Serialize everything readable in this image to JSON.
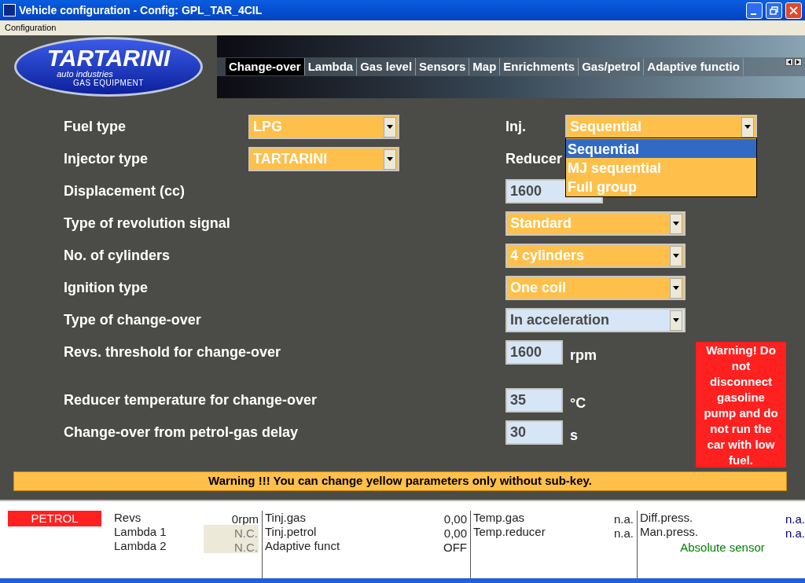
{
  "window": {
    "title": "Vehicle configuration - Config: GPL_TAR_4CIL"
  },
  "menu": [
    "Configuration"
  ],
  "logo": {
    "name": "TARTARINI",
    "subtitle": "auto industries",
    "tagline": "GAS EQUIPMENT"
  },
  "tabs": [
    {
      "label": "Change-over",
      "selected": true
    },
    {
      "label": "Lambda",
      "selected": false
    },
    {
      "label": "Gas level",
      "selected": false
    },
    {
      "label": "Sensors",
      "selected": false
    },
    {
      "label": "Map",
      "selected": false
    },
    {
      "label": "Enrichments",
      "selected": false
    },
    {
      "label": "Gas/petrol",
      "selected": false
    },
    {
      "label": "Adaptive functio",
      "selected": false
    }
  ],
  "form": {
    "groups": [
      [
        {
          "label": "Fuel type",
          "control": {
            "kind": "select",
            "value": "LPG",
            "editable": true
          },
          "side": {
            "label": "Inj.",
            "control": {
              "kind": "select",
              "value": "Sequential",
              "editable": true,
              "open": true,
              "options": [
                {
                  "label": "Sequential",
                  "selected": true
                },
                {
                  "label": "MJ sequential",
                  "selected": false
                },
                {
                  "label": "Full group",
                  "selected": false
                }
              ]
            }
          }
        },
        {
          "label": "Injector type",
          "control": {
            "kind": "select",
            "value": "TARTARINI",
            "editable": true
          },
          "side": {
            "label": "Reducer"
          }
        },
        {
          "label": "Displacement (cc)",
          "side": {
            "control": {
              "kind": "input",
              "value": "1600",
              "editable": false,
              "wide": true
            }
          }
        },
        {
          "label": "Type of revolution signal",
          "side": {
            "control": {
              "kind": "select",
              "value": "Standard",
              "editable": true
            }
          }
        },
        {
          "label": "No. of cylinders",
          "side": {
            "control": {
              "kind": "select",
              "value": "4 cylinders",
              "editable": true
            }
          }
        },
        {
          "label": "Ignition type",
          "side": {
            "control": {
              "kind": "select",
              "value": "One coil",
              "editable": true
            }
          }
        },
        {
          "label": "Type of change-over",
          "side": {
            "control": {
              "kind": "select",
              "value": "In acceleration",
              "editable": false
            }
          }
        },
        {
          "label": "Revs. threshold for change-over",
          "side": {
            "control": {
              "kind": "input",
              "value": "1600",
              "editable": false,
              "unit": "rpm"
            }
          }
        }
      ],
      [
        {
          "label": "Reducer temperature for change-over",
          "side": {
            "control": {
              "kind": "input",
              "value": "35",
              "editable": false,
              "unit": "°C"
            }
          }
        },
        {
          "label": "Change-over from petrol-gas delay",
          "side": {
            "control": {
              "kind": "input",
              "value": "30",
              "editable": false,
              "unit": "s"
            }
          }
        }
      ]
    ],
    "alert": "Warning! Do not disconnect gasoline pump and do not run the car with low fuel.",
    "notice": "Warning !!! You can change yellow parameters only without sub-key."
  },
  "status_bar": {
    "mode": "PETROL",
    "columns": [
      {
        "readings": [
          {
            "label": "Revs",
            "value": "0rpm",
            "disabled": false
          },
          {
            "label": "Lambda 1",
            "value": "N.C.",
            "disabled": true
          },
          {
            "label": "Lambda 2",
            "value": "N.C.",
            "disabled": true
          }
        ]
      },
      {
        "readings": [
          {
            "label": "Tinj.gas",
            "value": "0,00",
            "disabled": false
          },
          {
            "label": "Tinj.petrol",
            "value": "0,00",
            "disabled": false
          },
          {
            "label": "Adaptive funct",
            "value": "OFF",
            "disabled": false
          }
        ]
      },
      {
        "readings": [
          {
            "label": "Temp.gas",
            "value": "n.a.",
            "disabled": false,
            "color": "#222222"
          },
          {
            "label": "Temp.reducer",
            "value": "n.a.",
            "disabled": false,
            "color": "#222222"
          }
        ]
      },
      {
        "readings": [
          {
            "label": "Diff.press.",
            "value": "n.a.",
            "disabled": false,
            "color": "#000080"
          },
          {
            "label": "Man.press.",
            "value": "n.a.",
            "disabled": false,
            "color": "#000080"
          }
        ],
        "note": "Absolute sensor"
      }
    ]
  }
}
